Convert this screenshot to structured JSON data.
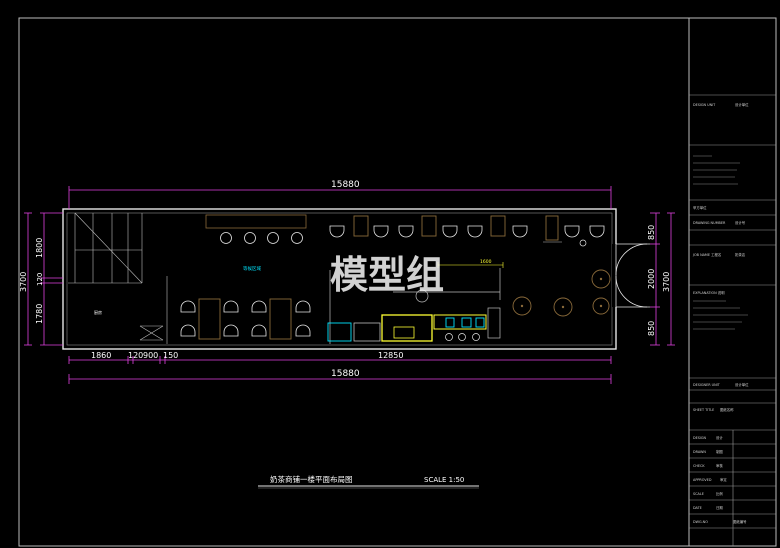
{
  "plan": {
    "title": "奶茶商铺一楼平面布局图",
    "scale": "SCALE 1:50",
    "watermark": "模型组",
    "top_dimension": "15880",
    "bottom_dimension": "15880",
    "bottom_segments": [
      "1860",
      "120",
      "900",
      "150",
      "12850"
    ],
    "left_dimensions": [
      "1800",
      "120",
      "1780"
    ],
    "left_total": "3700",
    "right_dimensions": [
      "850",
      "2000",
      "850"
    ],
    "right_total": "3700",
    "counter_dimension": "1600",
    "room_label": "厨房",
    "area_label": "等候区域"
  },
  "title_block": {
    "design_unit": "DESIGN UNIT",
    "design_unit_value": "设计单位",
    "client": "甲方单位",
    "client_value": "",
    "drawing_number": "DRAWING NUMBER",
    "drawing_number_value": "设计号",
    "job_name": "JOB NAME 工程名",
    "job_name_value": "奶茶店",
    "explanation": "EXPLANATION 说明",
    "designer_unit": "DESIGNER UNIT",
    "designer_unit_value": "设计单位",
    "sheet_title": "SHEET TITLE",
    "sheet_title_value": "图纸名称",
    "design": "DESIGN",
    "design_value": "设计",
    "drawn": "DRAWN",
    "drawn_value": "制图",
    "check": "CHECK",
    "check_value": "审核",
    "approved": "APPROVED",
    "approved_value": "审定",
    "scale_label": "SCALE",
    "scale_value": "比例",
    "date_label": "DATE",
    "date_value": "日期",
    "dwg_no": "DWG.NO",
    "dwg_no_value": "图纸编号"
  }
}
